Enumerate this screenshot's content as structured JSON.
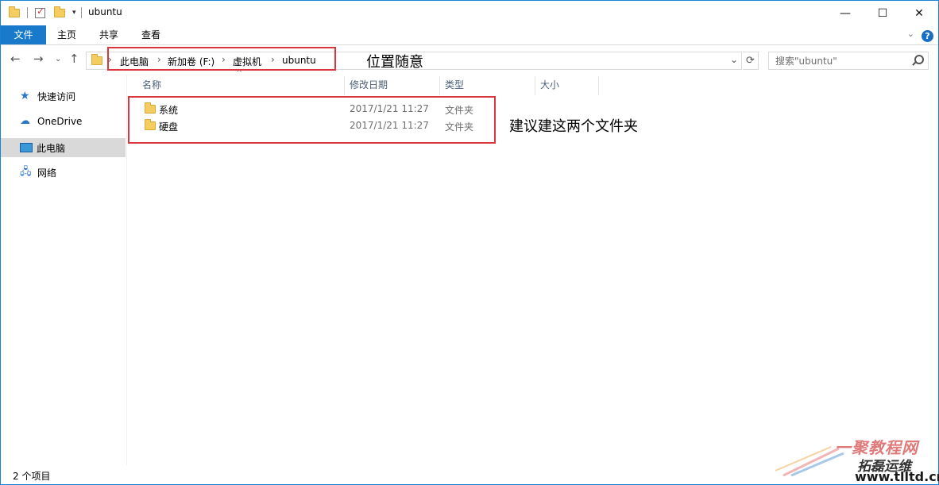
{
  "window": {
    "title": "ubuntu",
    "controls": {
      "minimize": "—",
      "maximize": "☐",
      "close": "✕"
    }
  },
  "ribbon": {
    "tabs": [
      "文件",
      "主页",
      "共享",
      "查看"
    ],
    "help": "?"
  },
  "address": {
    "breadcrumbs": [
      "此电脑",
      "新加卷 (F:)",
      "虚拟机",
      "ubuntu"
    ],
    "search_placeholder": "搜索\"ubuntu\""
  },
  "sidebar": {
    "items": [
      {
        "label": "快速访问",
        "icon": "star-icon"
      },
      {
        "label": "OneDrive",
        "icon": "cloud-icon"
      },
      {
        "label": "此电脑",
        "icon": "computer-icon",
        "selected": true
      },
      {
        "label": "网络",
        "icon": "network-icon"
      }
    ]
  },
  "columns": [
    "名称",
    "修改日期",
    "类型",
    "大小"
  ],
  "files": [
    {
      "name": "系统",
      "modified": "2017/1/21 11:27",
      "type": "文件夹"
    },
    {
      "name": "硬盘",
      "modified": "2017/1/21 11:27",
      "type": "文件夹"
    }
  ],
  "annotations": {
    "location_note": "位置随意",
    "folders_note": "建议建这两个文件夹"
  },
  "status": {
    "item_count": "2 个项目"
  },
  "watermark": {
    "line1": "一聚教程网",
    "line2": "拓磊运维",
    "url": "www.tlltd.cn"
  },
  "colors": {
    "accent": "#1979ca",
    "annotation_border": "#d9363e",
    "folder": "#f4cc5f"
  }
}
